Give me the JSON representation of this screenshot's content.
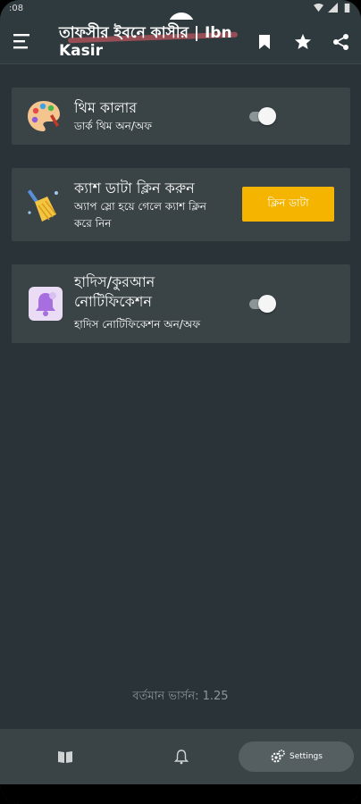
{
  "status_bar": {
    "time": ":08"
  },
  "app_bar": {
    "title": "তাফসীর ইবনে কাসীর | Ibn Kasir",
    "actions": [
      "bookmark-icon",
      "star-icon",
      "share-icon"
    ]
  },
  "settings": [
    {
      "title": "থিম কালার",
      "subtitle": "ডার্ক থিম অন/অফ",
      "control": "toggle",
      "toggle_on": true
    },
    {
      "title": "ক্যাশ ডাটা ক্লিন করুন",
      "subtitle": "অ্যাপ স্লো হয়ে গেলে ক্যাশ ক্লিন করে নিন",
      "button_label": "ক্লিন ডাটা"
    },
    {
      "title": "হাদিস/কুরআন নোটিফিকেশন",
      "subtitle": "হাদিস নোটিফিকেশন অন/অফ",
      "control": "toggle",
      "toggle_on": true
    }
  ],
  "version_text": "বর্তমান ভার্সন: 1.25",
  "bottom_nav": {
    "items": [
      {
        "icon": "quran-book-icon"
      },
      {
        "icon": "bell-icon"
      },
      {
        "icon": "settings-icon",
        "label": "Settings",
        "selected": true
      }
    ]
  },
  "colors": {
    "background": "#2a3438",
    "card": "#3a4346",
    "accent": "#f5b400"
  }
}
